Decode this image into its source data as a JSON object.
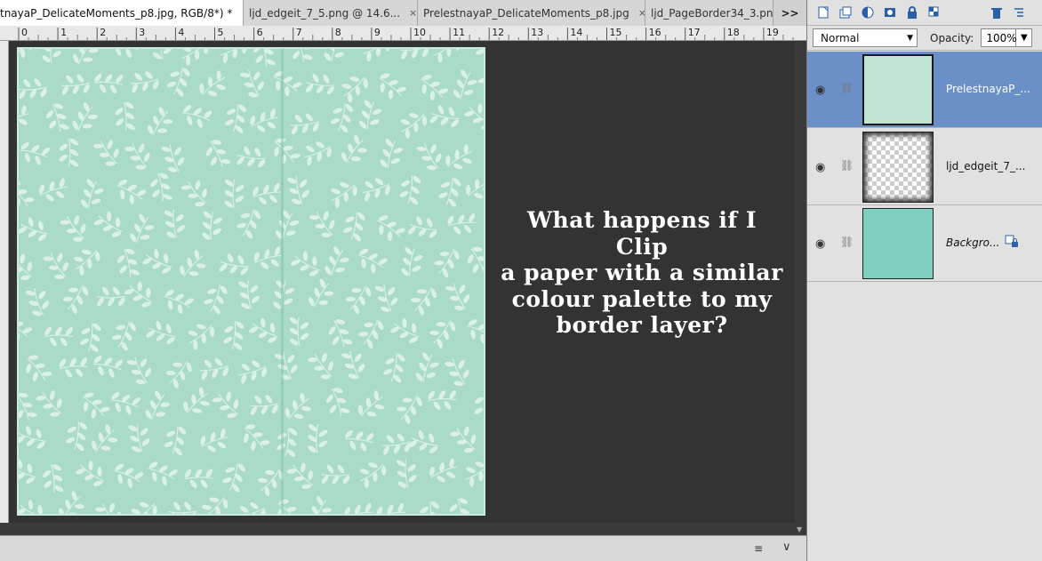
{
  "tabs": [
    {
      "label": "tnayaP_DelicateMoments_p8.jpg, RGB/8*) *",
      "close": "×",
      "active": true
    },
    {
      "label": "ljd_edgeit_7_5.png @ 14.6...",
      "close": "×",
      "active": false
    },
    {
      "label": "PrelestnayaP_DelicateMoments_p8.jpg",
      "close": "×",
      "active": false
    },
    {
      "label": "ljd_PageBorder34_3.pn",
      "close": "",
      "active": false
    }
  ],
  "tab_overflow": ">>",
  "ruler_labels": [
    "0",
    "1",
    "2",
    "3",
    "4",
    "5",
    "6",
    "7",
    "8",
    "9",
    "10",
    "11",
    "12",
    "13",
    "14",
    "15",
    "16",
    "17",
    "18",
    "19"
  ],
  "caption": {
    "lines": [
      "What happens if I Clip",
      "a paper with a similar",
      "colour palette to my",
      "border layer?"
    ]
  },
  "colors": {
    "paper": "#a9dbc6",
    "leaf": "#e4f4ec",
    "selection": "#6b8fc7",
    "canvas_bg": "#333333"
  },
  "layers_panel": {
    "toolbar_icons": [
      "new-layer-icon",
      "new-group-icon",
      "adjustment-layer-icon",
      "layer-mask-icon",
      "lock-all-icon",
      "lock-transparency-icon",
      "delete-layer-icon",
      "panel-menu-icon"
    ],
    "blend_mode": "Normal",
    "opacity_label": "Opacity:",
    "opacity_value": "100%",
    "layers": [
      {
        "name": "PrelestnayaP_...",
        "selected": true
      },
      {
        "name": "ljd_edgeit_7_...",
        "selected": false
      },
      {
        "name": "Backgro...",
        "selected": false,
        "locked": true
      }
    ]
  },
  "statusbar": {
    "menu_icon": "≡",
    "chevron": "∨"
  }
}
